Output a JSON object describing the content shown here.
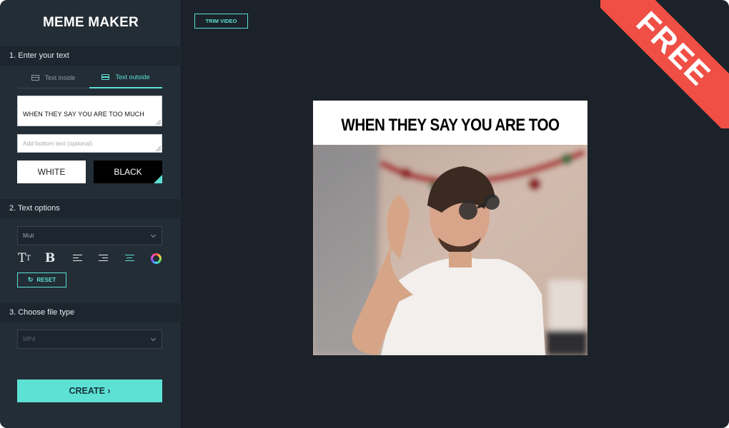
{
  "app": {
    "title": "MEME MAKER",
    "badge": "FREE"
  },
  "sections": {
    "text": "1. Enter your text",
    "options": "2. Text options",
    "filetype": "3. Choose file type"
  },
  "tabs": [
    {
      "label": "Text inside",
      "active": false
    },
    {
      "label": "Text outside",
      "active": true
    }
  ],
  "inputs": {
    "top_text": "WHEN THEY SAY YOU ARE TOO MUCH",
    "bottom_placeholder": "Add bottom text (optional)"
  },
  "color_buttons": {
    "white": "WHITE",
    "black": "BLACK",
    "selected": "BLACK"
  },
  "font_select": {
    "value": "Muli"
  },
  "tools": [
    "text-size-icon",
    "bold-icon",
    "align-left-icon",
    "align-right-icon",
    "align-center-icon",
    "color-wheel-icon"
  ],
  "reset_label": "RESET",
  "filetype_select": {
    "value": "MP4"
  },
  "create_label": "CREATE ›",
  "trim_label": "TRIM VIDEO",
  "meme": {
    "caption": "WHEN THEY SAY YOU ARE TOO MUCH"
  },
  "colors": {
    "accent": "#5de1d4",
    "ribbon": "#f04f45",
    "sidebar": "#232d36",
    "canvas": "#1b2229"
  }
}
